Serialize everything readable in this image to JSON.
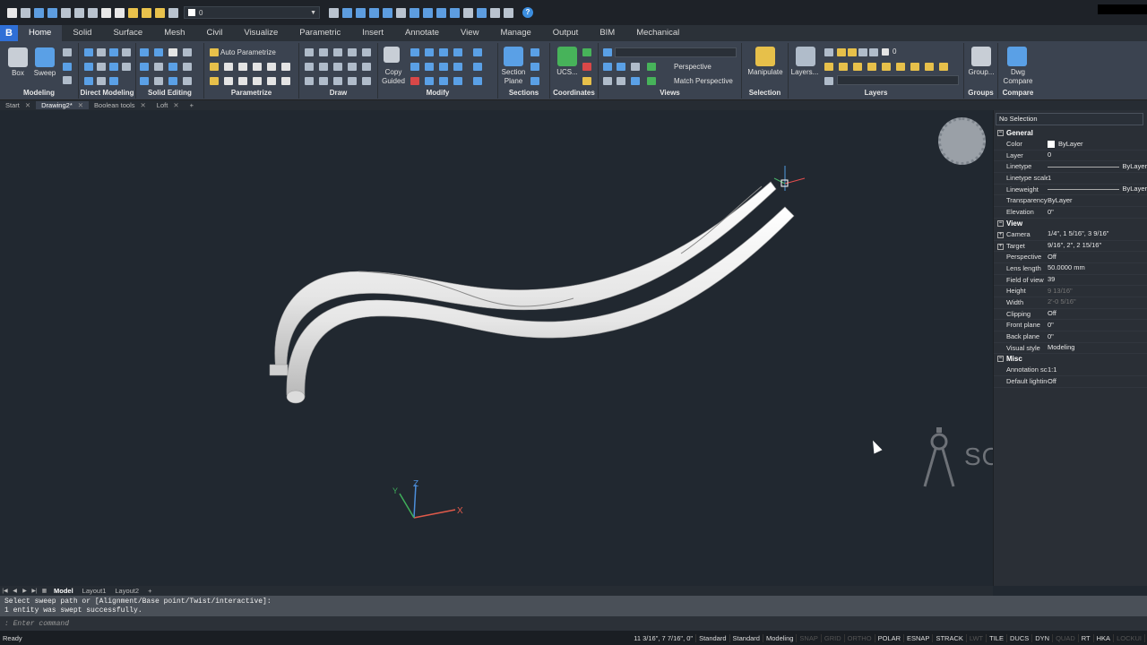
{
  "quick_access": {
    "layer_value": "0"
  },
  "ribbon_tabs": [
    "Home",
    "Solid",
    "Surface",
    "Mesh",
    "Civil",
    "Visualize",
    "Parametric",
    "Insert",
    "Annotate",
    "View",
    "Manage",
    "Output",
    "BIM",
    "Mechanical"
  ],
  "ribbon": {
    "modeling": {
      "label": "Modeling",
      "box": "Box",
      "sweep": "Sweep"
    },
    "direct_modeling": {
      "label": "Direct Modeling"
    },
    "solid_editing": {
      "label": "Solid Editing"
    },
    "parametrize": {
      "label": "Parametrize",
      "auto": "Auto Parametrize"
    },
    "draw": {
      "label": "Draw"
    },
    "modify": {
      "label": "Modify",
      "copy_guided": "Copy\nGuided"
    },
    "sections": {
      "label": "Sections",
      "section_plane": "Section\nPlane"
    },
    "coordinates": {
      "label": "Coordinates",
      "ucs": "UCS..."
    },
    "views": {
      "label": "Views",
      "perspective": "Perspective",
      "match_perspective": "Match Perspective"
    },
    "selection": {
      "label": "Selection",
      "manipulate": "Manipulate"
    },
    "layers": {
      "label": "Layers",
      "layers_btn": "Layers...",
      "layer_value": "0"
    },
    "groups": {
      "label": "Groups",
      "group_btn": "Group..."
    },
    "compare": {
      "label": "Compare",
      "dwg_compare": "Dwg\nCompare"
    }
  },
  "doc_tabs": [
    {
      "label": "Start"
    },
    {
      "label": "Drawing2*"
    },
    {
      "label": "Boolean tools"
    },
    {
      "label": "Loft"
    }
  ],
  "ucs_icon": {
    "x": "X",
    "y": "Y",
    "z": "Z"
  },
  "watermark": "SOURCECAD",
  "properties": {
    "selection": "No Selection",
    "sections": [
      {
        "title": "General",
        "rows": [
          {
            "k": "Color",
            "v": "ByLayer"
          },
          {
            "k": "Layer",
            "v": "0"
          },
          {
            "k": "Linetype",
            "v": "ByLayer"
          },
          {
            "k": "Linetype scale",
            "v": "1"
          },
          {
            "k": "Lineweight",
            "v": "ByLayer"
          },
          {
            "k": "Transparency",
            "v": "ByLayer"
          },
          {
            "k": "Elevation",
            "v": "0\""
          }
        ]
      },
      {
        "title": "View",
        "rows": [
          {
            "k": "Camera",
            "v": "1/4\", 1 5/16\", 3 9/16\""
          },
          {
            "k": "Target",
            "v": "9/16\", 2\", 2 15/16\""
          },
          {
            "k": "Perspective",
            "v": "Off"
          },
          {
            "k": "Lens length",
            "v": "50.0000 mm"
          },
          {
            "k": "Field of view",
            "v": "39"
          },
          {
            "k": "Height",
            "v": "9 13/16\""
          },
          {
            "k": "Width",
            "v": "2'-0 5/16\""
          },
          {
            "k": "Clipping",
            "v": "Off"
          },
          {
            "k": "Front plane",
            "v": "0\""
          },
          {
            "k": "Back plane",
            "v": "0\""
          },
          {
            "k": "Visual style",
            "v": "Modeling"
          }
        ]
      },
      {
        "title": "Misc",
        "rows": [
          {
            "k": "Annotation scale",
            "v": "1:1"
          },
          {
            "k": "Default lighting",
            "v": "Off"
          }
        ]
      }
    ]
  },
  "layout_tabs": [
    "Model",
    "Layout1",
    "Layout2"
  ],
  "command": {
    "history": [
      "Select sweep path or [Alignment/Base point/Twist/interactive]:",
      "1 entity was swept successfully."
    ],
    "prompt": ": Enter command"
  },
  "status": {
    "ready": "Ready",
    "coords": "11 3/16\", 7 7/16\", 0\"",
    "items": [
      "Standard",
      "Standard",
      "Modeling",
      "SNAP",
      "GRID",
      "ORTHO",
      "POLAR",
      "ESNAP",
      "STRACK",
      "LWT",
      "TILE",
      "DUCS",
      "DYN",
      "QUAD",
      "RT",
      "HKA",
      "LOCKUI"
    ],
    "off_items": [
      "SNAP",
      "GRID",
      "ORTHO",
      "LWT",
      "QUAD",
      "LOCKUI"
    ]
  }
}
